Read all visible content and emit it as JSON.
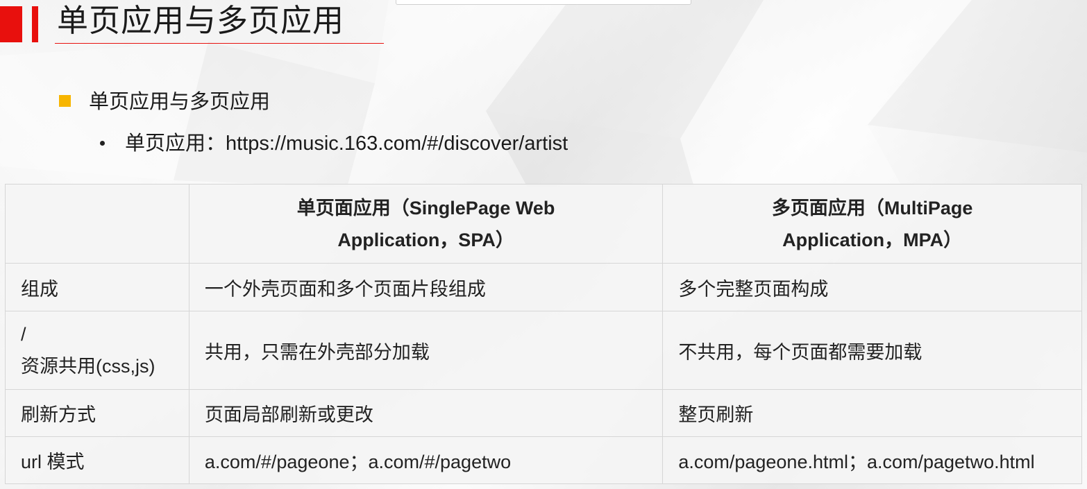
{
  "slide": {
    "title": "单页应用与多页应用",
    "bullet_level1": "单页应用与多页应用",
    "bullet_level2_label": "单页应用：",
    "bullet_level2_url": "https://music.163.com/#/discover/artist"
  },
  "table": {
    "headers": [
      "",
      "单页面应用（SinglePage Web Application，SPA）",
      "多页面应用（MultiPage Application，MPA）"
    ],
    "header_lines": {
      "spa_line1": "单页面应用（SinglePage Web",
      "spa_line2": "Application，SPA）",
      "mpa_line1": "多页面应用（MultiPage",
      "mpa_line2": "Application，MPA）"
    },
    "rows": [
      {
        "label": "组成",
        "spa": "一个外壳页面和多个页面片段组成",
        "mpa": "多个完整页面构成"
      },
      {
        "label_line1": "/",
        "label_line2": "资源共用(css,js)",
        "spa": "共用，只需在外壳部分加载",
        "mpa": "不共用，每个页面都需要加载"
      },
      {
        "label": "刷新方式",
        "spa": "页面局部刷新或更改",
        "mpa": "整页刷新"
      },
      {
        "label": "url 模式",
        "spa": "a.com/#/pageone；a.com/#/pagetwo",
        "mpa": "a.com/pageone.html；a.com/pagetwo.html"
      }
    ]
  },
  "colors": {
    "accent_red": "#e8100d",
    "bullet_yellow": "#f7b500",
    "table_border": "#d6d6d6"
  }
}
